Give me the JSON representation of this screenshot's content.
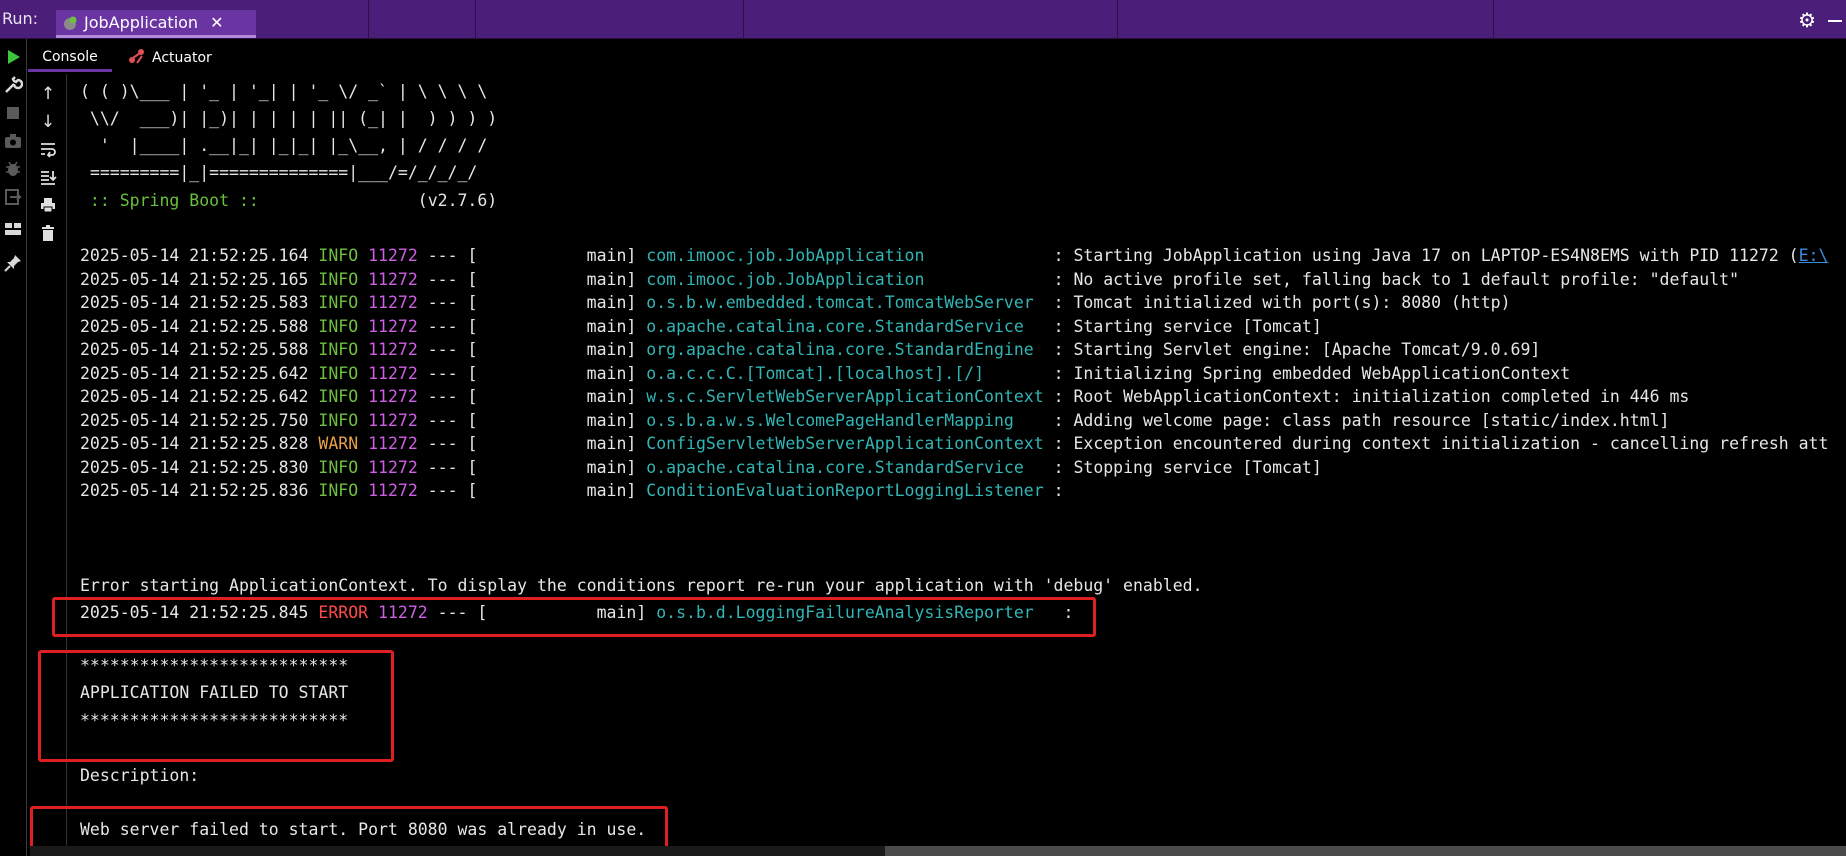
{
  "toolwindow": {
    "run_label": "Run:",
    "tab_title": "JobApplication",
    "close_glyph": "✕",
    "settings_glyph": "⚙"
  },
  "tabs": {
    "console": "Console",
    "actuator": "Actuator"
  },
  "gutter_icons": [
    "arrow-up-icon",
    "arrow-down-icon",
    "soft-wrap-icon",
    "scroll-to-end-icon",
    "print-icon",
    "trash-icon"
  ],
  "left_toolbar_icons": [
    "run-icon",
    "wrench-icon",
    "stop-icon",
    "camera-icon",
    "debug-icon",
    "exit-icon",
    "layout-icon",
    "pin-icon"
  ],
  "banner": [
    "( ( )\\___ | '_ | '_| | '_ \\/ _` | \\ \\ \\ \\",
    " \\\\/  ___)| |_)| | | | | || (_| |  ) ) ) )",
    "  '  |____| .__|_| |_|_| |_\\__, | / / / /",
    " =========|_|==============|___/=/_/_/_/"
  ],
  "spring_boot": {
    "label": " :: Spring Boot ::",
    "version": "(v2.7.6)"
  },
  "log": [
    {
      "ts": "2025-05-14 21:52:25.164",
      "level": "INFO",
      "pid": "11272",
      "thread": "--- [           main]",
      "logger": "com.imooc.job.JobApplication            ",
      "msg": ": Starting JobApplication using Java 17 on LAPTOP-ES4N8EMS with PID 11272 (",
      "link": "E:\\"
    },
    {
      "ts": "2025-05-14 21:52:25.165",
      "level": "INFO",
      "pid": "11272",
      "thread": "--- [           main]",
      "logger": "com.imooc.job.JobApplication            ",
      "msg": ": No active profile set, falling back to 1 default profile: \"default\"",
      "link": ""
    },
    {
      "ts": "2025-05-14 21:52:25.583",
      "level": "INFO",
      "pid": "11272",
      "thread": "--- [           main]",
      "logger": "o.s.b.w.embedded.tomcat.TomcatWebServer ",
      "msg": ": Tomcat initialized with port(s): 8080 (http)",
      "link": ""
    },
    {
      "ts": "2025-05-14 21:52:25.588",
      "level": "INFO",
      "pid": "11272",
      "thread": "--- [           main]",
      "logger": "o.apache.catalina.core.StandardService  ",
      "msg": ": Starting service [Tomcat]",
      "link": ""
    },
    {
      "ts": "2025-05-14 21:52:25.588",
      "level": "INFO",
      "pid": "11272",
      "thread": "--- [           main]",
      "logger": "org.apache.catalina.core.StandardEngine ",
      "msg": ": Starting Servlet engine: [Apache Tomcat/9.0.69]",
      "link": ""
    },
    {
      "ts": "2025-05-14 21:52:25.642",
      "level": "INFO",
      "pid": "11272",
      "thread": "--- [           main]",
      "logger": "o.a.c.c.C.[Tomcat].[localhost].[/]      ",
      "msg": ": Initializing Spring embedded WebApplicationContext",
      "link": ""
    },
    {
      "ts": "2025-05-14 21:52:25.642",
      "level": "INFO",
      "pid": "11272",
      "thread": "--- [           main]",
      "logger": "w.s.c.ServletWebServerApplicationContext",
      "msg": ": Root WebApplicationContext: initialization completed in 446 ms",
      "link": ""
    },
    {
      "ts": "2025-05-14 21:52:25.750",
      "level": "INFO",
      "pid": "11272",
      "thread": "--- [           main]",
      "logger": "o.s.b.a.w.s.WelcomePageHandlerMapping   ",
      "msg": ": Adding welcome page: class path resource [static/index.html]",
      "link": ""
    },
    {
      "ts": "2025-05-14 21:52:25.828",
      "level": "WARN",
      "pid": "11272",
      "thread": "--- [           main]",
      "logger": "ConfigServletWebServerApplicationContext",
      "msg": ": Exception encountered during context initialization - cancelling refresh att",
      "link": ""
    },
    {
      "ts": "2025-05-14 21:52:25.830",
      "level": "INFO",
      "pid": "11272",
      "thread": "--- [           main]",
      "logger": "o.apache.catalina.core.StandardService  ",
      "msg": ": Stopping service [Tomcat]",
      "link": ""
    },
    {
      "ts": "2025-05-14 21:52:25.836",
      "level": "INFO",
      "pid": "11272",
      "thread": "--- [           main]",
      "logger": "ConditionEvaluationReportLoggingListener",
      "msg": ":",
      "link": ""
    }
  ],
  "error_context_msg": "Error starting ApplicationContext. To display the conditions report re-run your application with 'debug' enabled.",
  "error_line": {
    "ts": "2025-05-14 21:52:25.845",
    "level": "ERROR",
    "pid": "11272",
    "thread": "--- [           main]",
    "logger": "o.s.b.d.LoggingFailureAnalysisReporter  ",
    "msg": ":"
  },
  "stars": "***************************",
  "failed_title": "APPLICATION FAILED TO START",
  "description_label": "Description:",
  "description_text": "Web server failed to start. Port 8080 was already in use.",
  "colors": {
    "info": "#6fbf3f",
    "warn": "#e8a04a",
    "error": "#ff4a4a",
    "pid": "#d05ee6",
    "logger": "#31b5b5",
    "highlight": "#e02020",
    "topbar": "#4b1e7a"
  }
}
